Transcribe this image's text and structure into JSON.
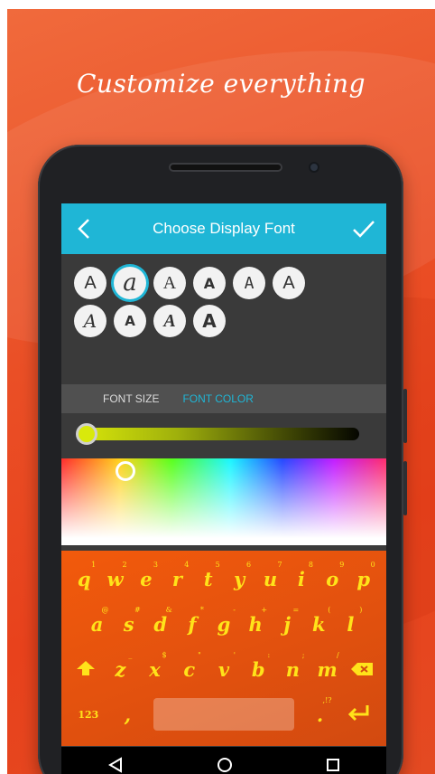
{
  "promo": {
    "headline": "Customize everything"
  },
  "appbar": {
    "title": "Choose Display Font"
  },
  "font_picker": {
    "row1": [
      "A",
      "a",
      "A",
      "A",
      "A",
      "A"
    ],
    "row2": [
      "A",
      "A",
      "A",
      "A"
    ],
    "selected_index": 1
  },
  "tabs": {
    "size": "FONT SIZE",
    "color": "FONT COLOR",
    "active": "FONT COLOR"
  },
  "colors": {
    "accent": "#1fb6d6",
    "key_text": "#ffe31a",
    "slider_color": "#d9e90c"
  },
  "keyboard": {
    "row1": [
      {
        "k": "q",
        "h": "1"
      },
      {
        "k": "w",
        "h": "2"
      },
      {
        "k": "e",
        "h": "3"
      },
      {
        "k": "r",
        "h": "4"
      },
      {
        "k": "t",
        "h": "5"
      },
      {
        "k": "y",
        "h": "6"
      },
      {
        "k": "u",
        "h": "7"
      },
      {
        "k": "i",
        "h": "8"
      },
      {
        "k": "o",
        "h": "9"
      },
      {
        "k": "p",
        "h": "0"
      }
    ],
    "row2": [
      {
        "k": "a",
        "h": "@"
      },
      {
        "k": "s",
        "h": "#"
      },
      {
        "k": "d",
        "h": "&"
      },
      {
        "k": "f",
        "h": "*"
      },
      {
        "k": "g",
        "h": "-"
      },
      {
        "k": "h",
        "h": "+"
      },
      {
        "k": "j",
        "h": "="
      },
      {
        "k": "k",
        "h": "("
      },
      {
        "k": "l",
        "h": ")"
      }
    ],
    "row3": [
      {
        "k": "z",
        "h": "_"
      },
      {
        "k": "x",
        "h": "$"
      },
      {
        "k": "c",
        "h": "\""
      },
      {
        "k": "v",
        "h": "'"
      },
      {
        "k": "b",
        "h": ":"
      },
      {
        "k": "n",
        "h": ";"
      },
      {
        "k": "m",
        "h": "/"
      }
    ],
    "symbols_label": "123",
    "comma": ",",
    "period": ".",
    "period_hint": ",!?"
  }
}
